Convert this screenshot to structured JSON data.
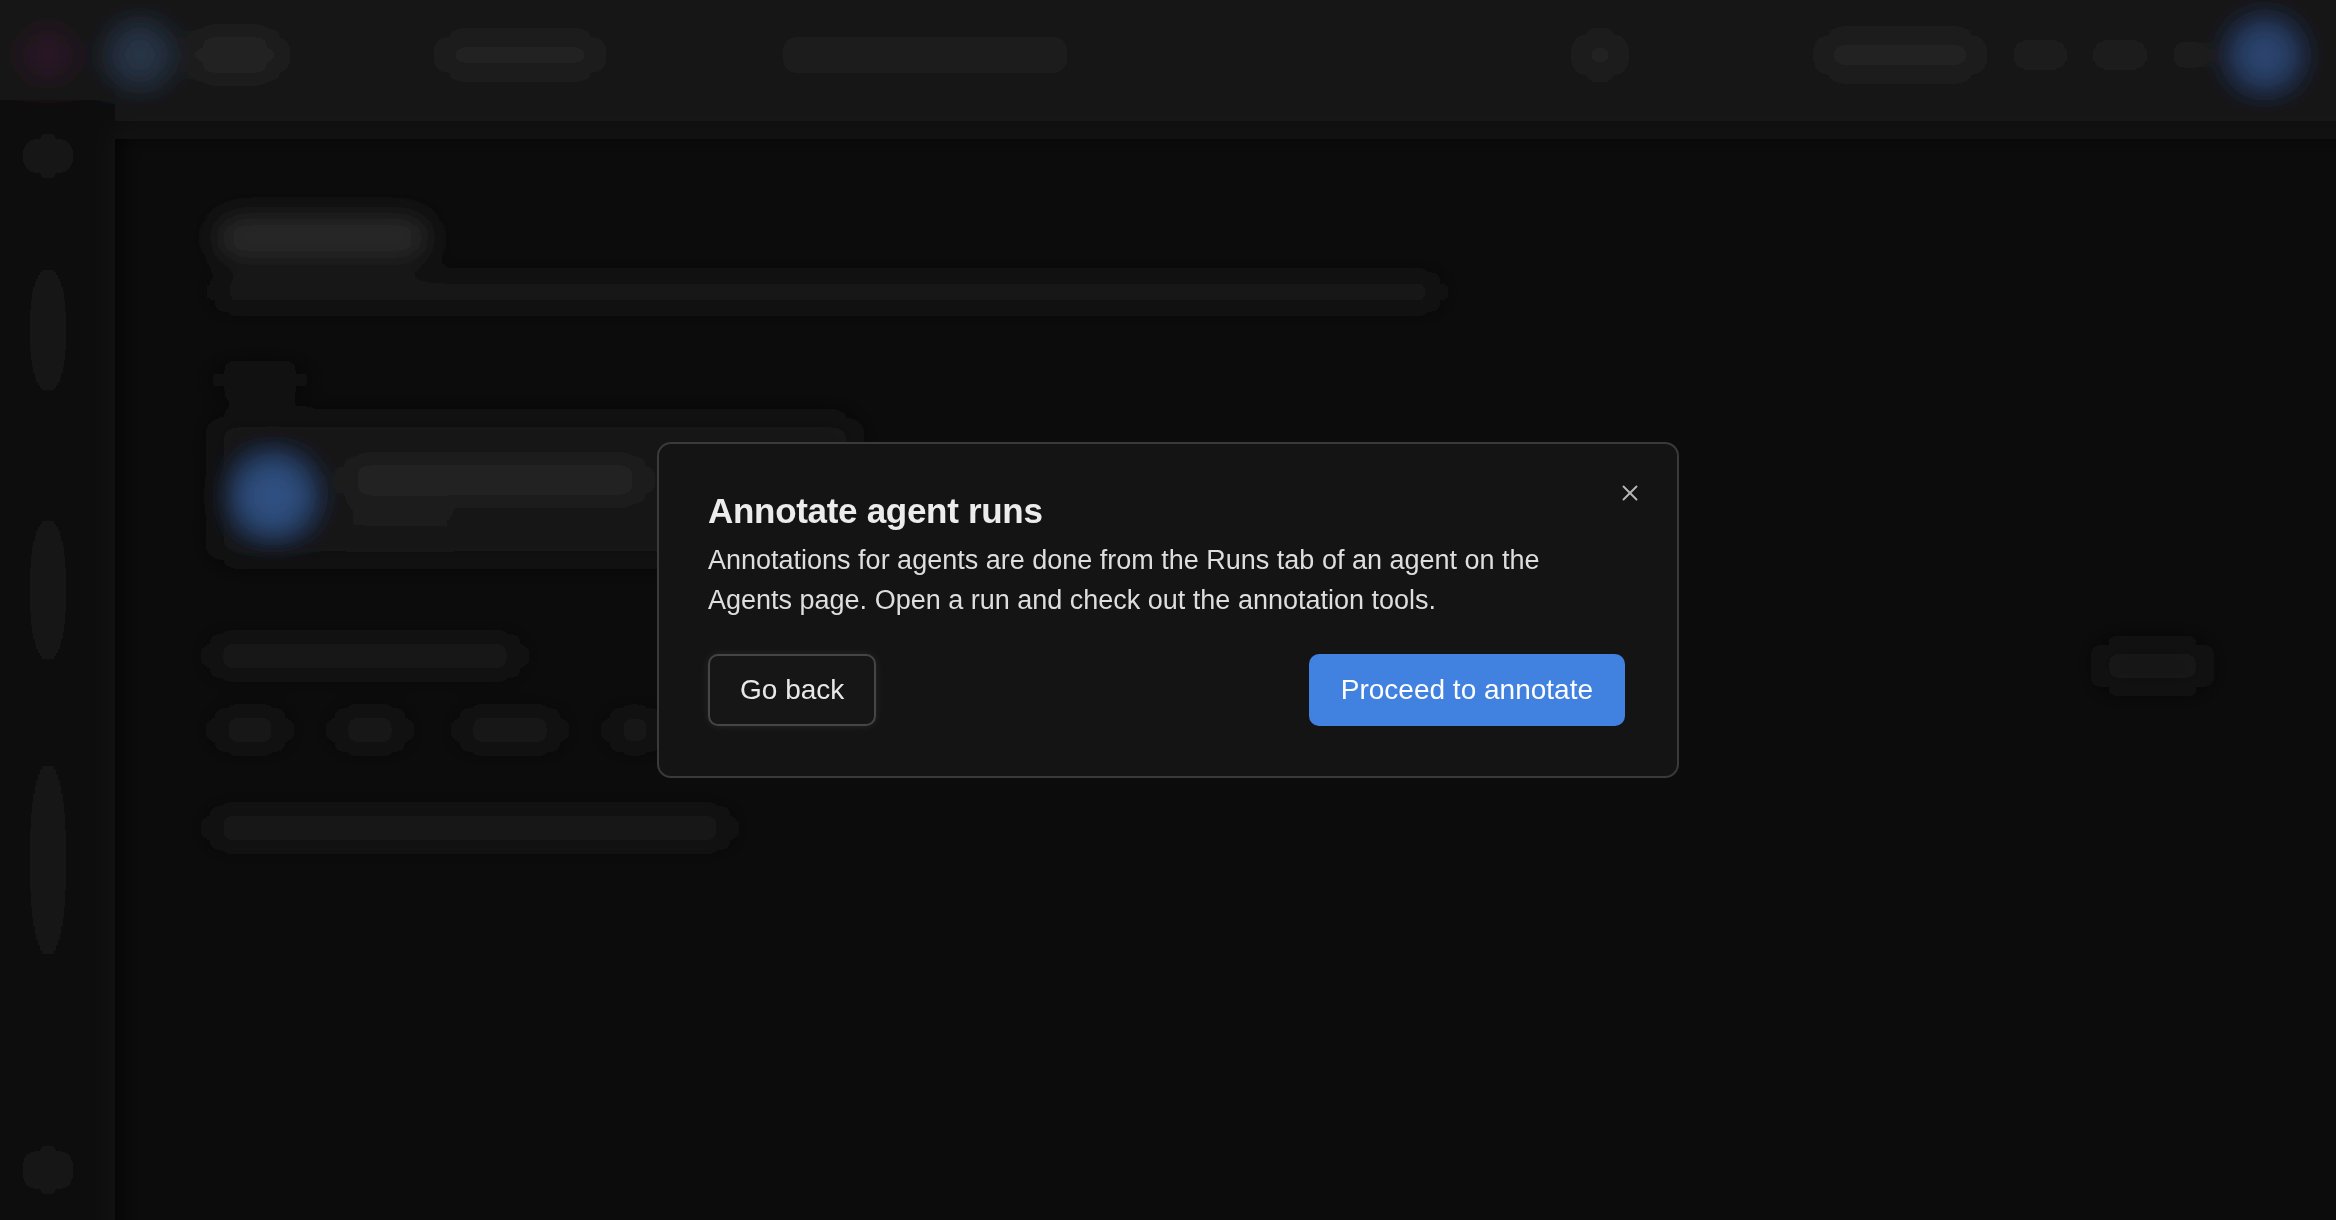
{
  "dialog": {
    "title": "Annotate agent runs",
    "message": "Annotations for agents are done from the Runs tab of an agent on the Agents page. Open a run and check out the annotation tools.",
    "buttons": [
      {
        "label": "Go back",
        "kind": "secondary"
      },
      {
        "label": "Proceed to annotate",
        "kind": "primary"
      }
    ]
  }
}
